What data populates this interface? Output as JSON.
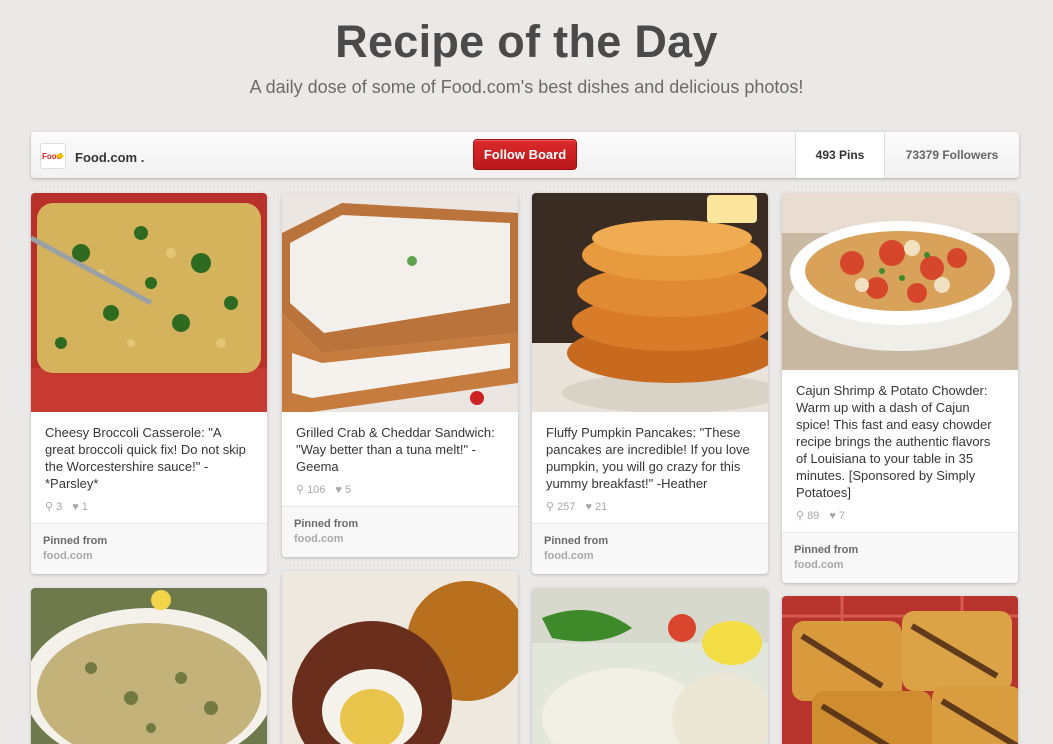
{
  "header": {
    "title": "Recipe of the Day",
    "subtitle": "A daily dose of some of Food.com's best dishes and delicious photos!"
  },
  "board": {
    "owner_name": "Food.com .",
    "follow_label": "Follow Board",
    "pins_count": "493 Pins",
    "followers_count": "73379 Followers"
  },
  "pins": [
    {
      "description": "Cheesy Broccoli Casserole: \"A great broccoli quick fix! Do not skip the Worcestershire sauce!\" -*Parsley*",
      "repins": "3",
      "likes": "1",
      "pinned_from_label": "Pinned from",
      "source": "food.com"
    },
    {
      "description": "Grilled Crab & Cheddar Sandwich: \"Way better than a tuna melt!\" -Geema",
      "repins": "106",
      "likes": "5",
      "pinned_from_label": "Pinned from",
      "source": "food.com"
    },
    {
      "description": "Fluffy Pumpkin Pancakes: \"These pancakes are incredible! If you love pumpkin, you will go crazy for this yummy breakfast!\" -Heather",
      "repins": "257",
      "likes": "21",
      "pinned_from_label": "Pinned from",
      "source": "food.com"
    },
    {
      "description": "Cajun Shrimp & Potato Chowder: Warm up with a dash of Cajun spice! This fast and easy chowder recipe brings the authentic flavors of Louisiana to your table in 35 minutes. [Sponsored by Simply Potatoes]",
      "repins": "89",
      "likes": "7",
      "pinned_from_label": "Pinned from",
      "source": "food.com"
    }
  ],
  "colors": {
    "follow_button": "#c91a1f",
    "background": "#ece9e9"
  }
}
